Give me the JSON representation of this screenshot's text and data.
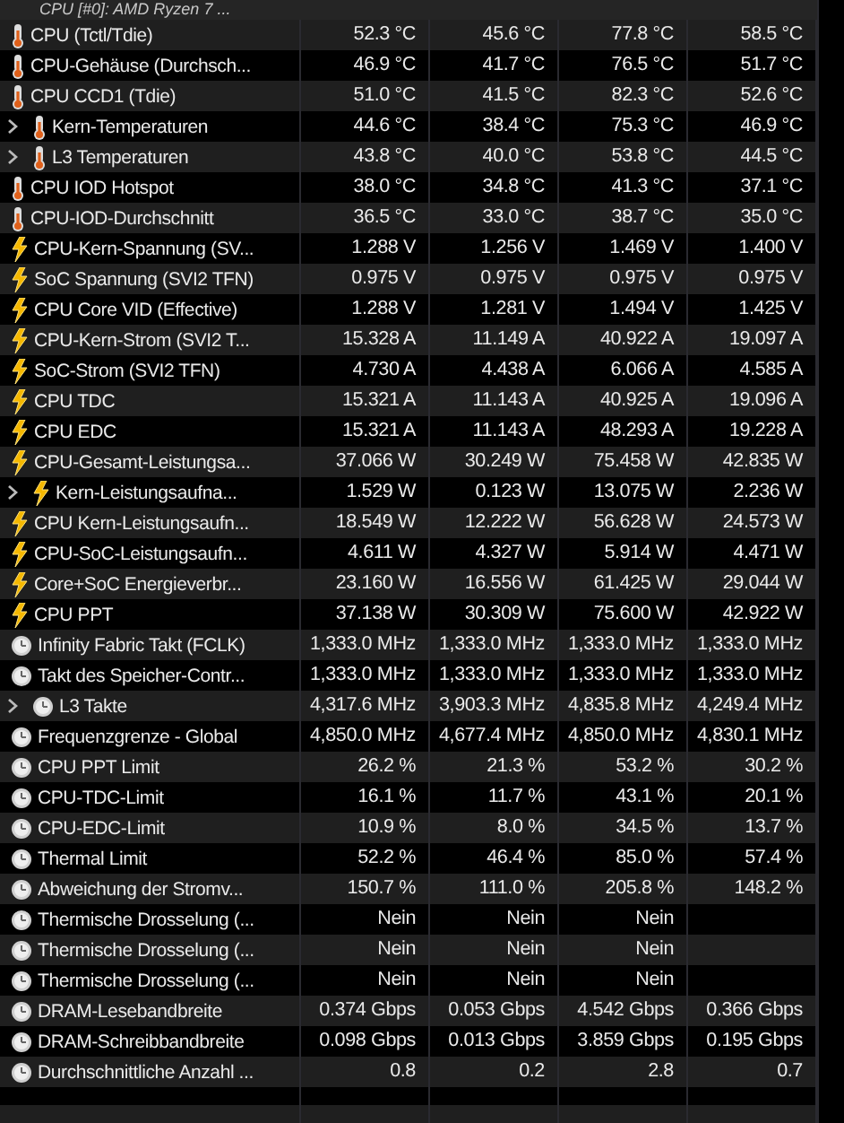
{
  "sensor_group": {
    "title": "CPU [#0]: AMD Ryzen 7 ..."
  },
  "rows": [
    {
      "kind": "temp",
      "group": false,
      "name": "CPU (Tctl/Tdie)",
      "values": [
        "52.3 °C",
        "45.6 °C",
        "77.8 °C",
        "58.5 °C"
      ]
    },
    {
      "kind": "temp",
      "group": false,
      "name": "CPU-Gehäuse (Durchsch...",
      "values": [
        "46.9 °C",
        "41.7 °C",
        "76.5 °C",
        "51.7 °C"
      ]
    },
    {
      "kind": "temp",
      "group": false,
      "name": "CPU CCD1 (Tdie)",
      "values": [
        "51.0 °C",
        "41.5 °C",
        "82.3 °C",
        "52.6 °C"
      ]
    },
    {
      "kind": "temp",
      "group": true,
      "name": "Kern-Temperaturen",
      "values": [
        "44.6 °C",
        "38.4 °C",
        "75.3 °C",
        "46.9 °C"
      ]
    },
    {
      "kind": "temp",
      "group": true,
      "name": "L3 Temperaturen",
      "values": [
        "43.8 °C",
        "40.0 °C",
        "53.8 °C",
        "44.5 °C"
      ]
    },
    {
      "kind": "temp",
      "group": false,
      "name": "CPU IOD Hotspot",
      "values": [
        "38.0 °C",
        "34.8 °C",
        "41.3 °C",
        "37.1 °C"
      ]
    },
    {
      "kind": "temp",
      "group": false,
      "name": "CPU-IOD-Durchschnitt",
      "values": [
        "36.5 °C",
        "33.0 °C",
        "38.7 °C",
        "35.0 °C"
      ]
    },
    {
      "kind": "power",
      "group": false,
      "name": "CPU-Kern-Spannung (SV...",
      "values": [
        "1.288 V",
        "1.256 V",
        "1.469 V",
        "1.400 V"
      ]
    },
    {
      "kind": "power",
      "group": false,
      "name": "SoC Spannung (SVI2 TFN)",
      "values": [
        "0.975 V",
        "0.975 V",
        "0.975 V",
        "0.975 V"
      ]
    },
    {
      "kind": "power",
      "group": false,
      "name": "CPU Core VID (Effective)",
      "values": [
        "1.288 V",
        "1.281 V",
        "1.494 V",
        "1.425 V"
      ]
    },
    {
      "kind": "power",
      "group": false,
      "name": "CPU-Kern-Strom (SVI2 T...",
      "values": [
        "15.328 A",
        "11.149 A",
        "40.922 A",
        "19.097 A"
      ]
    },
    {
      "kind": "power",
      "group": false,
      "name": "SoC-Strom (SVI2 TFN)",
      "values": [
        "4.730 A",
        "4.438 A",
        "6.066 A",
        "4.585 A"
      ]
    },
    {
      "kind": "power",
      "group": false,
      "name": "CPU TDC",
      "values": [
        "15.321 A",
        "11.143 A",
        "40.925 A",
        "19.096 A"
      ]
    },
    {
      "kind": "power",
      "group": false,
      "name": "CPU EDC",
      "values": [
        "15.321 A",
        "11.143 A",
        "48.293 A",
        "19.228 A"
      ]
    },
    {
      "kind": "power",
      "group": false,
      "name": "CPU-Gesamt-Leistungsa...",
      "values": [
        "37.066 W",
        "30.249 W",
        "75.458 W",
        "42.835 W"
      ]
    },
    {
      "kind": "power",
      "group": true,
      "name": "Kern-Leistungsaufna...",
      "values": [
        "1.529 W",
        "0.123 W",
        "13.075 W",
        "2.236 W"
      ]
    },
    {
      "kind": "power",
      "group": false,
      "name": "CPU Kern-Leistungsaufn...",
      "values": [
        "18.549 W",
        "12.222 W",
        "56.628 W",
        "24.573 W"
      ]
    },
    {
      "kind": "power",
      "group": false,
      "name": "CPU-SoC-Leistungsaufn...",
      "values": [
        "4.611 W",
        "4.327 W",
        "5.914 W",
        "4.471 W"
      ]
    },
    {
      "kind": "power",
      "group": false,
      "name": "Core+SoC Energieverbr...",
      "values": [
        "23.160 W",
        "16.556 W",
        "61.425 W",
        "29.044 W"
      ]
    },
    {
      "kind": "power",
      "group": false,
      "name": "CPU PPT",
      "values": [
        "37.138 W",
        "30.309 W",
        "75.600 W",
        "42.922 W"
      ]
    },
    {
      "kind": "clock",
      "group": false,
      "name": "Infinity Fabric Takt (FCLK)",
      "values": [
        "1,333.0 MHz",
        "1,333.0 MHz",
        "1,333.0 MHz",
        "1,333.0 MHz"
      ]
    },
    {
      "kind": "clock",
      "group": false,
      "name": "Takt des Speicher-Contr...",
      "values": [
        "1,333.0 MHz",
        "1,333.0 MHz",
        "1,333.0 MHz",
        "1,333.0 MHz"
      ]
    },
    {
      "kind": "clock",
      "group": true,
      "name": "L3 Takte",
      "values": [
        "4,317.6 MHz",
        "3,903.3 MHz",
        "4,835.8 MHz",
        "4,249.4 MHz"
      ]
    },
    {
      "kind": "clock",
      "group": false,
      "name": "Frequenzgrenze - Global",
      "values": [
        "4,850.0 MHz",
        "4,677.4 MHz",
        "4,850.0 MHz",
        "4,830.1 MHz"
      ]
    },
    {
      "kind": "clock",
      "group": false,
      "name": "CPU PPT Limit",
      "values": [
        "26.2 %",
        "21.3 %",
        "53.2 %",
        "30.2 %"
      ]
    },
    {
      "kind": "clock",
      "group": false,
      "name": "CPU-TDC-Limit",
      "values": [
        "16.1 %",
        "11.7 %",
        "43.1 %",
        "20.1 %"
      ]
    },
    {
      "kind": "clock",
      "group": false,
      "name": "CPU-EDC-Limit",
      "values": [
        "10.9 %",
        "8.0 %",
        "34.5 %",
        "13.7 %"
      ]
    },
    {
      "kind": "clock",
      "group": false,
      "name": "Thermal Limit",
      "values": [
        "52.2 %",
        "46.4 %",
        "85.0 %",
        "57.4 %"
      ]
    },
    {
      "kind": "clock",
      "group": false,
      "name": "Abweichung der Stromv...",
      "values": [
        "150.7 %",
        "111.0 %",
        "205.8 %",
        "148.2 %"
      ]
    },
    {
      "kind": "clock",
      "group": false,
      "name": "Thermische Drosselung (...",
      "values": [
        "Nein",
        "Nein",
        "Nein"
      ]
    },
    {
      "kind": "clock",
      "group": false,
      "name": "Thermische Drosselung (...",
      "values": [
        "Nein",
        "Nein",
        "Nein"
      ]
    },
    {
      "kind": "clock",
      "group": false,
      "name": "Thermische Drosselung (...",
      "values": [
        "Nein",
        "Nein",
        "Nein"
      ]
    },
    {
      "kind": "clock",
      "group": false,
      "name": "DRAM-Lesebandbreite",
      "values": [
        "0.374 Gbps",
        "0.053 Gbps",
        "4.542 Gbps",
        "0.366 Gbps"
      ]
    },
    {
      "kind": "clock",
      "group": false,
      "name": "DRAM-Schreibbandbreite",
      "values": [
        "0.098 Gbps",
        "0.013 Gbps",
        "3.859 Gbps",
        "0.195 Gbps"
      ]
    },
    {
      "kind": "clock",
      "group": false,
      "name": "Durchschnittliche Anzahl ...",
      "values": [
        "0.8",
        "0.2",
        "2.8",
        "0.7"
      ]
    }
  ]
}
